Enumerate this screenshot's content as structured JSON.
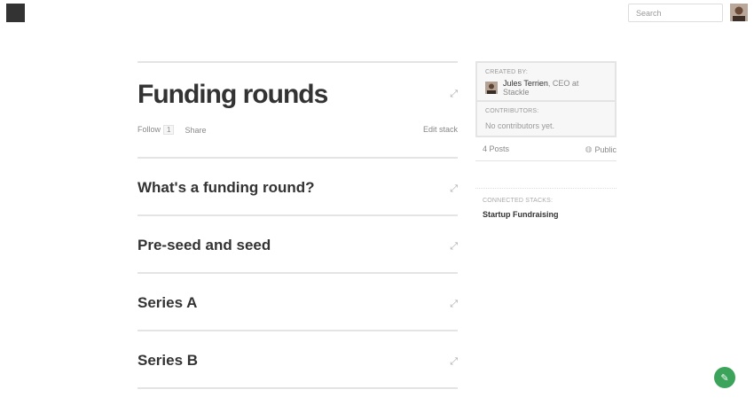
{
  "header": {
    "search_placeholder": "Search",
    "logo_icon": "square-logo",
    "avatar_icon": "user-avatar"
  },
  "stack": {
    "title": "Funding rounds",
    "follow_label": "Follow",
    "follow_count": "1",
    "share_label": "Share",
    "edit_label": "Edit stack",
    "expand_icon": "expand-arrows-icon"
  },
  "sections": [
    {
      "title": "What's a funding round?"
    },
    {
      "title": "Pre-seed and seed"
    },
    {
      "title": "Series A"
    },
    {
      "title": "Series B"
    }
  ],
  "sidebar": {
    "created_by_label": "CREATED BY:",
    "creator_name": "Jules Terrien",
    "creator_role": ", CEO at Stackle",
    "contributors_label": "CONTRIBUTORS:",
    "contributors_empty": "No contributors yet.",
    "posts": "4 Posts",
    "visibility": "Public",
    "connected_label": "CONNECTED STACKS:",
    "connected_stacks": [
      "Startup Fundraising"
    ]
  },
  "fab": {
    "icon": "pencil-icon"
  },
  "colors": {
    "fab": "#3ca35b",
    "logo": "#333333",
    "rule": "#e4e4e4"
  }
}
